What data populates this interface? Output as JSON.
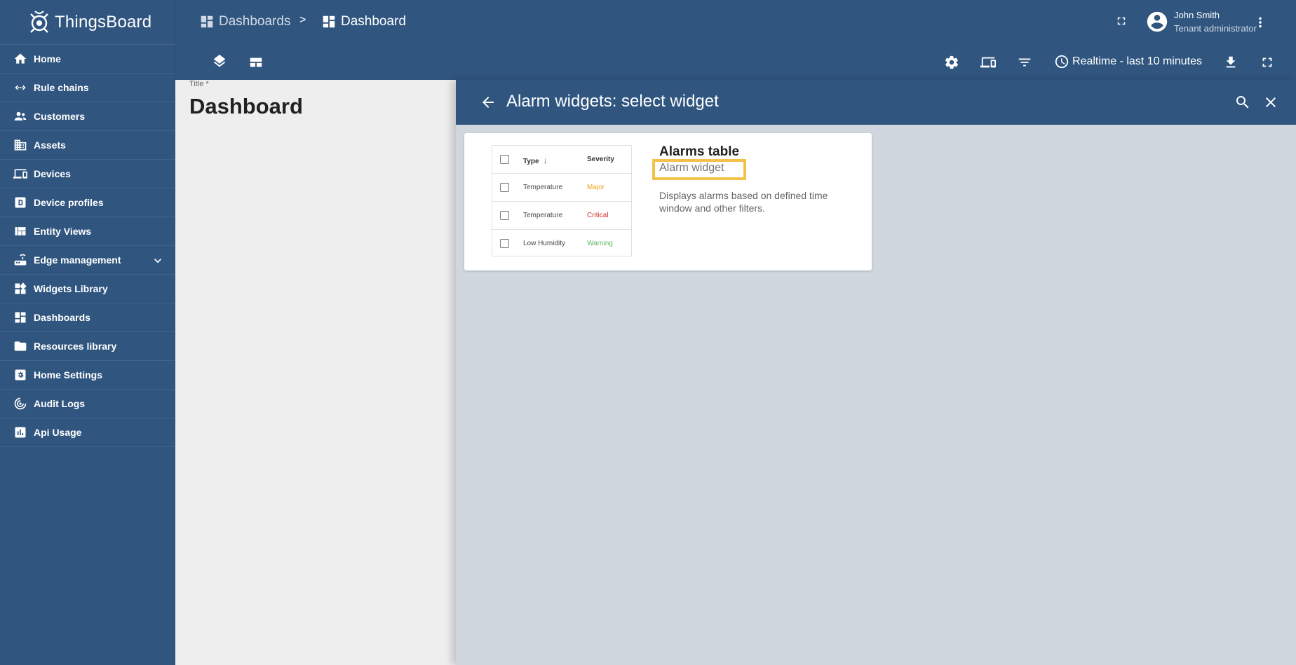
{
  "app": {
    "name": "ThingsBoard"
  },
  "sidebar": {
    "items": [
      {
        "label": "Home",
        "icon": "home-icon"
      },
      {
        "label": "Rule chains",
        "icon": "rule-chains-icon"
      },
      {
        "label": "Customers",
        "icon": "customers-icon"
      },
      {
        "label": "Assets",
        "icon": "assets-icon"
      },
      {
        "label": "Devices",
        "icon": "devices-icon"
      },
      {
        "label": "Device profiles",
        "icon": "device-profiles-icon"
      },
      {
        "label": "Entity Views",
        "icon": "entity-views-icon"
      },
      {
        "label": "Edge management",
        "icon": "edge-icon"
      },
      {
        "label": "Widgets Library",
        "icon": "widgets-icon"
      },
      {
        "label": "Dashboards",
        "icon": "dashboards-icon"
      },
      {
        "label": "Resources library",
        "icon": "folder-icon"
      },
      {
        "label": "Home Settings",
        "icon": "settings-icon"
      },
      {
        "label": "Audit Logs",
        "icon": "audit-icon"
      },
      {
        "label": "Api Usage",
        "icon": "api-usage-icon"
      }
    ]
  },
  "header": {
    "breadcrumb": [
      {
        "label": "Dashboards"
      },
      {
        "label": "Dashboard"
      }
    ],
    "separator": ">",
    "user": {
      "name": "John Smith",
      "role": "Tenant administrator"
    }
  },
  "toolbar": {
    "timewindow": "Realtime - last 10 minutes"
  },
  "dashboard": {
    "title_label": "Title *",
    "title": "Dashboard"
  },
  "panel": {
    "title": "Alarm widgets: select widget",
    "widget": {
      "name": "Alarms table",
      "type": "Alarm widget",
      "description": "Displays alarms based on defined time window and other filters.",
      "preview": {
        "headers": [
          "Type",
          "Severity"
        ],
        "rows": [
          {
            "type": "Temperature",
            "severity": "Major",
            "color": "#f0a41c"
          },
          {
            "type": "Temperature",
            "severity": "Critical",
            "color": "#d32f2f"
          },
          {
            "type": "Low Humidity",
            "severity": "Warning",
            "color": "#5fb55f"
          }
        ]
      }
    }
  },
  "colors": {
    "primary": "#305680",
    "highlight": "#f2c24b"
  }
}
